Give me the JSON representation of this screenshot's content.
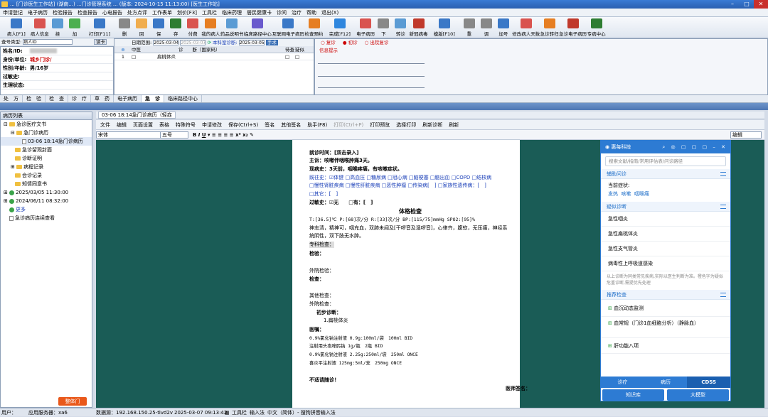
{
  "titlebar": {
    "text": "... [门诊医生工作站] (湖南...) ...门诊管理系统 ... (版本: 2024-10-15 11:13:00) [医生工作站]"
  },
  "menu": [
    "申请登记",
    "电子病历",
    "检验报告",
    "检查报告",
    "心电报告",
    "处方点评",
    "工作表单",
    "划价[F3]",
    "工具栏",
    "临床药理",
    "居民健康卡",
    "诊间",
    "治疗",
    "帮助",
    "退出(X)"
  ],
  "toolbar": [
    {
      "label": "病人[F1]",
      "color": "#3a78c7"
    },
    {
      "label": "病人信息",
      "color": "#d9534f"
    },
    {
      "label": "挂",
      "color": "#5a9bd4"
    },
    {
      "label": "加",
      "color": "#4caf50"
    },
    {
      "label": "打印[F11]",
      "color": "#3a78c7"
    },
    {
      "label": "删",
      "color": "#888"
    },
    {
      "label": "回",
      "color": "#f0ad4e"
    },
    {
      "label": "保",
      "color": "#3a78c7"
    },
    {
      "label": "存",
      "color": "#2e7d32"
    },
    {
      "label": "付费",
      "color": "#d9534f"
    },
    {
      "label": "我的病人",
      "color": "#e67e22"
    },
    {
      "label": "药品说明书",
      "color": "#5a9bd4"
    },
    {
      "label": "临床路径中心",
      "color": "#6a5acd"
    },
    {
      "label": "互联网电子病历",
      "color": "#3a78c7"
    },
    {
      "label": "检查预约",
      "color": "#e67e22"
    },
    {
      "label": "完成[F12]",
      "color": "#2e86de"
    },
    {
      "label": "电子病历",
      "color": "#d9534f"
    },
    {
      "label": "下",
      "color": "#888"
    },
    {
      "label": "转诊",
      "color": "#5a9bd4"
    },
    {
      "label": "新冠病毒",
      "color": "#c0392b"
    },
    {
      "label": "模版[F10]",
      "color": "#3a78c7"
    },
    {
      "label": "重",
      "color": "#888"
    },
    {
      "label": "调",
      "color": "#888"
    },
    {
      "label": "加号",
      "color": "#3a78c7"
    },
    {
      "label": "修改病人天数",
      "color": "#d9534f"
    },
    {
      "label": "急诊转归",
      "color": "#e67e22"
    },
    {
      "label": "急诊电子病历",
      "color": "#c0392b"
    },
    {
      "label": "专病中心",
      "color": "#2e7d32"
    }
  ],
  "search": {
    "label": "查号类型:",
    "value": "病人ID",
    "btn": "读卡"
  },
  "patient": {
    "name_lbl": "姓名/ID:",
    "unit_lbl": "身份/单位:",
    "unit_val": "城乡门诊/",
    "sex_lbl": "性别/年龄:",
    "sex_val": "男/16岁",
    "allergy_lbl": "过敏史:",
    "physio_lbl": "生理状态:"
  },
  "diag": {
    "date_lbl": "日期范围:",
    "date_from": "2025-03-04",
    "date_to": "2025-03-07",
    "text_lbl": "本科室诊断:",
    "text_date": "2025-03-05",
    "btn": "手术",
    "col_cat": "中医",
    "col_diag": "诊　　断（国家码）",
    "col_a": "待查",
    "col_b": "疑似",
    "row_no": "1",
    "row_val": "扁桃体炎"
  },
  "rtop": {
    "opt1": "复诊",
    "opt2": "初诊",
    "opt3": "出院复诊",
    "hint": "信息提示"
  },
  "tabs": [
    "处　方",
    "检　验",
    "检　查",
    "诊　疗",
    "草　药",
    "电子病历",
    "急　诊",
    "临床路径中心"
  ],
  "left": {
    "header": "病历列表",
    "items": [
      "急诊医疗文书",
      "急门诊病历",
      "03-06 18:14急门诊病历",
      "急诊留观封面",
      "诊断证明",
      "病程记录",
      "会诊记录",
      "知情同意书",
      "2025/03/05 11:30:00",
      "2024/06/11 08:32:00",
      "更多",
      "急诊病历连续查看"
    ],
    "seal": "整体门"
  },
  "doc": {
    "tab": "03-06 18:14急门诊病历（轻症",
    "menu": [
      "文件",
      "编辑",
      "页面设置",
      "表格",
      "特殊符号",
      "申请修改",
      "保存(Ctrl+S)",
      "签名",
      "其他签名",
      "助手(F8)",
      "打印(Ctrl+P)",
      "打印预览",
      "选择打印",
      "刷新诊断",
      "刷新"
    ],
    "font": "宋体",
    "size": "五号",
    "mode": "编辑"
  },
  "page": {
    "visit": "就诊时间：[双击录入]",
    "chief": "主诉：咳嗽伴咽喉肿痛3天。",
    "history": "现病史：3天前，咽喉疼痛，有咳嗽症状。",
    "past1": "既往史：☑体健 □高血压 □糖尿病 □冠心病 □脑梗塞 □脑出血 □COPD □结核病",
    "past2": "□慢性肾脏疾病 □慢性肝脏疾病 □恶性肿瘤 □传染病[　] □家族性遗传病：[　]",
    "past3": "□其它：[　]",
    "allergy": "过敏史：☑无　　□有：[　]",
    "exam_title": "体格检查",
    "vitals": "T:[36.5]℃ P:[68]次/分 R:[33]次/分 BP:[115/75]mmHg SPO2:[95]%",
    "exam1": "神志清，精神可，咽充血，双肺未闻及[干啰音及湿啰音]，心律齐，腹软，无压痛，神经系",
    "exam2": "统阴性，双下肢无水肿。",
    "special": "专科检查：",
    "lab": "检验：",
    "outlab": "外院检验：",
    "imaging": "检查：",
    "other": "其他检查：",
    "outimg": "外院检查：",
    "dx": "初步诊断：",
    "dx1": "1.扁桃体炎",
    "rx": "医嘱：",
    "rx1": "0.9%氯化钠注射液 0.9g:100ml/袋　100ml BID",
    "rx2": "注射用头孢唑肟钠 1g/瓶　2瓶 BID",
    "rx3": "0.9%氯化钠注射液 2.25g:250ml/袋　250ml ONCE",
    "rx4": "喜炎平注射液 125mg:5ml/支　250mg ONCE",
    "followup": "不适请随诊！",
    "signature": "医师签名："
  },
  "cdss": {
    "brand": "惠每科技",
    "search": "搜索文献/指南/常用评估表/问诊路径",
    "s_assist": "辅助问诊",
    "cur_sym": "当前症状:",
    "syms": [
      "发热",
      "咳嗽",
      "咽喉痛"
    ],
    "s_suspect": "疑似诊断",
    "suspects": [
      "急性咽炎",
      "急性扁桃体炎",
      "急性支气管炎",
      "病毒性上呼吸道感染"
    ],
    "note": "以上诊断为同类常见疾病,实际以医生判断为准。橙色字为疑似危重诊断,需提优先处理",
    "s_exam": "推荐检查",
    "exams": [
      "血沉动态监测",
      "血常规（门诊1血细胞分析）（静脉血）",
      "肝功能八项"
    ],
    "tabs": [
      "诊疗",
      "病历",
      "CDSS"
    ],
    "btn1": "知识库",
    "btn2": "大模型"
  },
  "status": {
    "user": "用户：",
    "server": "应用服务器：xa6",
    "ip": "数据源：192.168.150.25-tivd2v",
    "time": "2025-03-07 09:13:42",
    "tools": "工具栏",
    "input": "输入法",
    "ime": "中文（简体）- 搜狗拼音输入法"
  }
}
